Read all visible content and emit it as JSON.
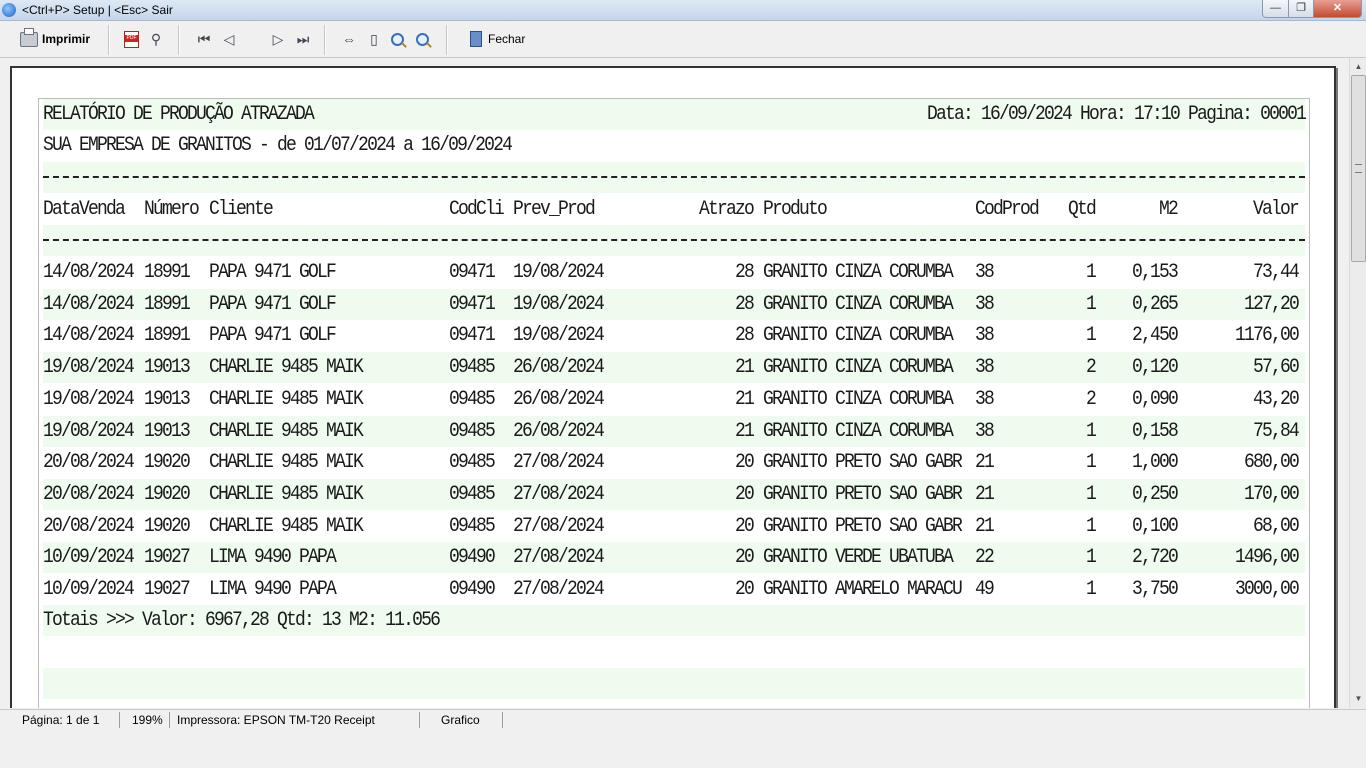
{
  "window": {
    "title": "<Ctrl+P> Setup | <Esc> Sair",
    "close_glyph": "✕",
    "max_glyph": "❐",
    "min_glyph": "—"
  },
  "toolbar": {
    "print_label": "Imprimir",
    "close_label": "Fechar",
    "glyphs": {
      "first": "⏮",
      "prev": "◁",
      "next": "▷",
      "last": "⏭",
      "binoculars": "⚲",
      "page_width": "⇔",
      "page_single": "▯"
    }
  },
  "report": {
    "title": "RELATÓRIO DE PRODUÇÃO ATRAZADA",
    "header_meta": "Data: 16/09/2024 Hora: 17:10 Pagina: 00001",
    "subtitle": "SUA EMPRESA DE GRANITOS - de 01/07/2024 a 16/09/2024",
    "columns": [
      "DataVenda",
      "Número",
      "Cliente",
      "CodCli",
      "Prev_Prod",
      "Atrazo",
      "Produto",
      "CodProd",
      "Qtd",
      "M2",
      "Valor"
    ],
    "rows": [
      [
        "14/08/2024",
        "18991",
        "PAPA 9471 GOLF",
        "09471",
        "19/08/2024",
        "28",
        "GRANITO CINZA CORUMBA",
        "38",
        "1",
        "0,153",
        "73,44"
      ],
      [
        "14/08/2024",
        "18991",
        "PAPA 9471 GOLF",
        "09471",
        "19/08/2024",
        "28",
        "GRANITO CINZA CORUMBA",
        "38",
        "1",
        "0,265",
        "127,20"
      ],
      [
        "14/08/2024",
        "18991",
        "PAPA 9471 GOLF",
        "09471",
        "19/08/2024",
        "28",
        "GRANITO CINZA CORUMBA",
        "38",
        "1",
        "2,450",
        "1176,00"
      ],
      [
        "19/08/2024",
        "19013",
        "CHARLIE 9485 MAIK",
        "09485",
        "26/08/2024",
        "21",
        "GRANITO CINZA CORUMBA",
        "38",
        "2",
        "0,120",
        "57,60"
      ],
      [
        "19/08/2024",
        "19013",
        "CHARLIE 9485 MAIK",
        "09485",
        "26/08/2024",
        "21",
        "GRANITO CINZA CORUMBA",
        "38",
        "2",
        "0,090",
        "43,20"
      ],
      [
        "19/08/2024",
        "19013",
        "CHARLIE 9485 MAIK",
        "09485",
        "26/08/2024",
        "21",
        "GRANITO CINZA CORUMBA",
        "38",
        "1",
        "0,158",
        "75,84"
      ],
      [
        "20/08/2024",
        "19020",
        "CHARLIE 9485 MAIK",
        "09485",
        "27/08/2024",
        "20",
        "GRANITO PRETO SAO GABR",
        "21",
        "1",
        "1,000",
        "680,00"
      ],
      [
        "20/08/2024",
        "19020",
        "CHARLIE 9485 MAIK",
        "09485",
        "27/08/2024",
        "20",
        "GRANITO PRETO SAO GABR",
        "21",
        "1",
        "0,250",
        "170,00"
      ],
      [
        "20/08/2024",
        "19020",
        "CHARLIE 9485 MAIK",
        "09485",
        "27/08/2024",
        "20",
        "GRANITO PRETO SAO GABR",
        "21",
        "1",
        "0,100",
        "68,00"
      ],
      [
        "10/09/2024",
        "19027",
        "LIMA 9490 PAPA",
        "09490",
        "27/08/2024",
        "20",
        "GRANITO VERDE UBATUBA",
        "22",
        "1",
        "2,720",
        "1496,00"
      ],
      [
        "10/09/2024",
        "19027",
        "LIMA 9490 PAPA",
        "09490",
        "27/08/2024",
        "20",
        "GRANITO AMARELO MARACU",
        "49",
        "1",
        "3,750",
        "3000,00"
      ]
    ],
    "totals": "Totais >>> Valor: 6967,28 Qtd: 13 M2: 11.056"
  },
  "statusbar": {
    "page": "Página: 1 de 1",
    "zoom": "199%",
    "printer": "Impressora: EPSON TM-T20 Receipt",
    "mode": "Grafico"
  },
  "colors": {
    "band_green": "#eefbee",
    "close_red": "#c24a32"
  }
}
